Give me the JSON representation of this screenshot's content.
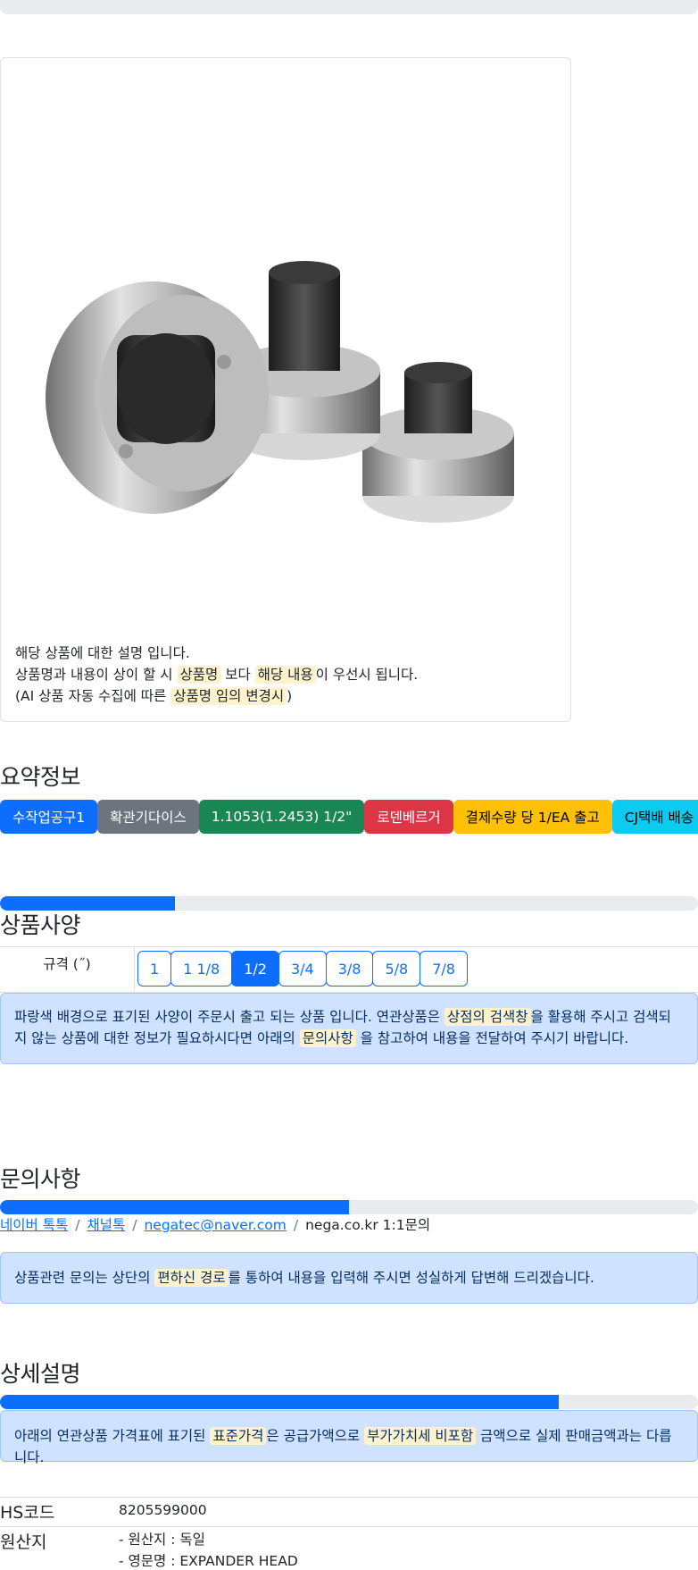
{
  "product": {
    "notes": {
      "line1": "해당 상품에 대한 설명 입니다.",
      "line2_pre": "상품명과 내용이 상이 할 시 ",
      "line2_hl1": "상품명",
      "line2_mid": " 보다 ",
      "line2_hl2": "해당 내용",
      "line2_post": "이 우선시 됩니다.",
      "line3_pre": "(AI 상품 자동 수집에 따른 ",
      "line3_hl": "상품명 임의 변경시",
      "line3_post": ")"
    }
  },
  "summary": {
    "title": "요약정보",
    "badges": [
      {
        "label": "수작업공구1",
        "color": "#0d6efd",
        "text_color": "#ffffff"
      },
      {
        "label": "확관기다이스",
        "color": "#6c757d",
        "text_color": "#ffffff"
      },
      {
        "label": "1.1053(1.2453) 1/2\"",
        "color": "#198754",
        "text_color": "#ffffff"
      },
      {
        "label": "로덴베르거",
        "color": "#dc3545",
        "text_color": "#ffffff"
      },
      {
        "label": "결제수량 당 1/EA 출고",
        "color": "#ffc107",
        "text_color": "#000000"
      },
      {
        "label": "CJ택배 배송",
        "color": "#0dcaf0",
        "text_color": "#000000"
      }
    ]
  },
  "specs": {
    "title": "상품사양",
    "progress": 0.25,
    "label": "규격 (˝)",
    "options": [
      "1",
      "1 1/8",
      "1/2",
      "3/4",
      "3/8",
      "5/8",
      "7/8"
    ],
    "selected": "1/2",
    "notice_pre": "파랑색 배경으로 표기된 사양이 주문시 출고 되는 상품 입니다. 연관상품은 ",
    "notice_hl1": "상점의 검색창",
    "notice_mid": "을 활용해 주시고 검색되지 않는 상품에 대한 정보가 필요하시다면 아래의 ",
    "notice_hl2": "문의사항",
    "notice_post": " 을 참고하여 내용을 전달하여 주시기 바랍니다."
  },
  "inquiry": {
    "title": "문의사항",
    "progress": 0.5,
    "links": [
      "네이버 톡톡",
      "채널톡",
      "negatec@naver.com"
    ],
    "plain": "nega.co.kr 1:1문의",
    "notice_pre": "상품관련 문의는 상단의 ",
    "notice_hl": "편하신 경로",
    "notice_post": "를 통하여 내용을 입력해 주시면 성실하게 답변해 드리겠습니다."
  },
  "detail": {
    "title": "상세설명",
    "progress": 0.8,
    "notice_pre": "아래의 연관상품 가격표에 표기된 ",
    "notice_hl1": "표준가격",
    "notice_mid": "은 공급가액으로 ",
    "notice_hl2": "부가가치세 비포함",
    "notice_post": " 금액으로 실제 판매금액과는 다릅니다."
  },
  "info": {
    "hs_key": "HS코드",
    "hs_value": "8205599000",
    "origin_key": "원산지",
    "origin_line1": "- 원산지 : 독일",
    "origin_line2": "- 영문명 : EXPANDER HEAD"
  }
}
